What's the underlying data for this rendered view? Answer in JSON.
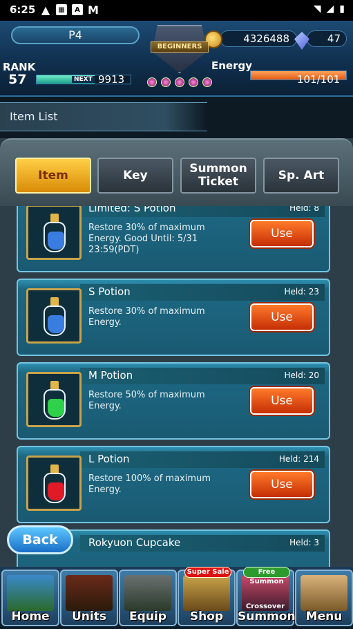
{
  "status_bar": {
    "time": "6:25",
    "notif_icons": [
      "warning-icon",
      "app-icon",
      "a-icon",
      "gmail-icon"
    ]
  },
  "hud": {
    "player_name": "P4",
    "coins": "4326488",
    "gems": "47",
    "rank_label": "RANK",
    "rank": "57",
    "next_label": "NEXT",
    "next_exp": "9913",
    "exp_fraction": 0.62,
    "energy_label": "Energy",
    "energy": "101/101",
    "energy_fraction": 1.0,
    "emblem_banner": "BEGINNERS"
  },
  "page_title": "Item List",
  "tabs": [
    {
      "label": "Item",
      "active": true
    },
    {
      "label": "Key",
      "active": false
    },
    {
      "label": "Summon Ticket",
      "active": false
    },
    {
      "label": "Sp. Art",
      "active": false
    }
  ],
  "items": [
    {
      "name": "Limited: S Potion",
      "held": "Held: 8",
      "desc": "Restore 30% of maximum Energy. Good Until: 5/31 23:59(PDT)",
      "action": "Use",
      "color": "#3a7de0"
    },
    {
      "name": "S Potion",
      "held": "Held: 23",
      "desc": "Restore 30% of maximum Energy.",
      "action": "Use",
      "color": "#3a7de0"
    },
    {
      "name": "M Potion",
      "held": "Held: 20",
      "desc": "Restore 50% of maximum Energy.",
      "action": "Use",
      "color": "#2fd04a"
    },
    {
      "name": "L Potion",
      "held": "Held: 214",
      "desc": "Restore 100% of maximum Energy.",
      "action": "Use",
      "color": "#e01a26"
    },
    {
      "name": "Rokyuon Cupcake",
      "held": "Held: 3",
      "desc": "",
      "action": "",
      "color": "#c9a44a"
    }
  ],
  "back_label": "Back",
  "nav": [
    {
      "label": "Home",
      "badge": ""
    },
    {
      "label": "Units",
      "badge": ""
    },
    {
      "label": "Equip",
      "badge": ""
    },
    {
      "label": "Shop",
      "badge": "Super Sale"
    },
    {
      "label": "Summon",
      "badge": "Free Summon",
      "sublabel": "Crossover"
    },
    {
      "label": "Menu",
      "badge": ""
    }
  ]
}
